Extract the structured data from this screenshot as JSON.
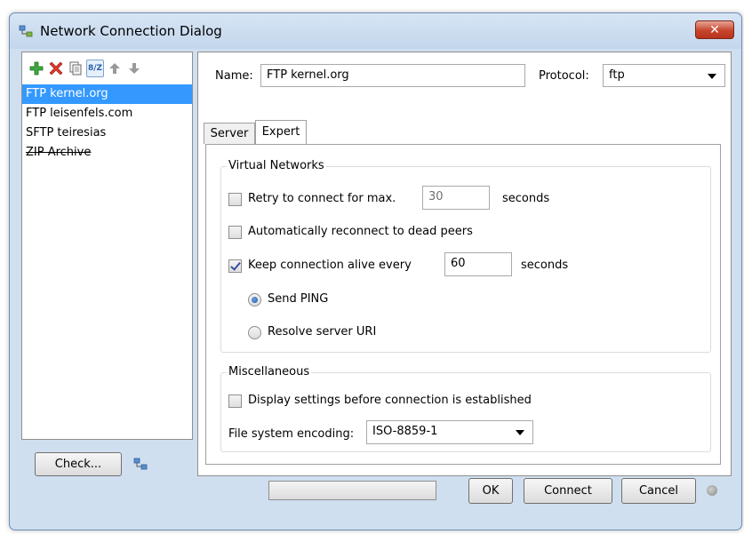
{
  "window": {
    "title": "Network Connection Dialog",
    "close_label": "✕"
  },
  "toolbar": {
    "icons": [
      "add-icon",
      "delete-icon",
      "copy-icon",
      "sort-icon",
      "up-arrow-icon",
      "down-arrow-icon"
    ],
    "sort_label": "8/Z"
  },
  "connections": {
    "items": [
      {
        "label": "FTP kernel.org",
        "selected": true
      },
      {
        "label": "FTP leisenfels.com",
        "selected": false
      },
      {
        "label": "SFTP teiresias",
        "selected": false
      },
      {
        "label": "ZIP Archive",
        "selected": false,
        "strikethrough": true
      }
    ]
  },
  "check": {
    "label": "Check..."
  },
  "form": {
    "name_label": "Name:",
    "name_value": "FTP kernel.org",
    "protocol_label": "Protocol:",
    "protocol_value": "ftp"
  },
  "tabs": [
    {
      "label": "Server",
      "active": false
    },
    {
      "label": "Expert",
      "active": true
    }
  ],
  "virtual_networks": {
    "title": "Virtual Networks",
    "retry_label": "Retry to connect for max.",
    "retry_checked": false,
    "retry_value": "30",
    "retry_unit": "seconds",
    "reconnect_label": "Automatically reconnect to dead peers",
    "reconnect_checked": false,
    "keepalive_label": "Keep connection alive every",
    "keepalive_checked": true,
    "keepalive_value": "60",
    "keepalive_unit": "seconds",
    "send_ping_label": "Send PING",
    "send_ping_selected": true,
    "resolve_label": "Resolve server URI",
    "resolve_selected": false
  },
  "misc": {
    "title": "Miscellaneous",
    "display_label": "Display settings before connection is established",
    "display_checked": false,
    "encoding_label": "File system encoding:",
    "encoding_value": "ISO-8859-1"
  },
  "footer": {
    "progress": 0,
    "ok_label": "OK",
    "connect_label": "Connect",
    "cancel_label": "Cancel"
  },
  "colors": {
    "selection": "#3399ff",
    "window_bg": "#cfdff0",
    "close_button": "#c7442b"
  }
}
